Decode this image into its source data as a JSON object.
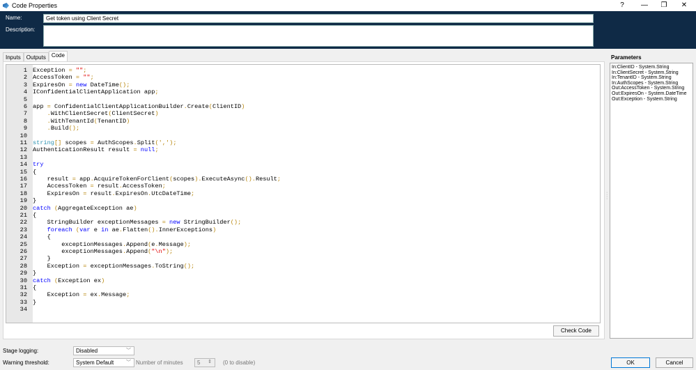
{
  "window": {
    "title": "Code Properties",
    "help": "?",
    "minimize": "—",
    "restore": "❐",
    "close": "✕"
  },
  "header": {
    "name_label": "Name:",
    "name_value": "Get token using Client Secret",
    "description_label": "Description:",
    "description_value": ""
  },
  "tabs": [
    {
      "label": "Inputs"
    },
    {
      "label": "Outputs"
    },
    {
      "label": "Code"
    }
  ],
  "code_lines": [
    "Exception = \"\";",
    "AccessToken = \"\";",
    "ExpiresOn = new DateTime();",
    "IConfidentialClientApplication app;",
    "",
    "app = ConfidentialClientApplicationBuilder.Create(ClientID)",
    "    .WithClientSecret(ClientSecret)",
    "    .WithTenantId(TenantID)",
    "    .Build();",
    "",
    "string[] scopes = AuthScopes.Split(',');",
    "AuthenticationResult result = null;",
    "",
    "try",
    "{",
    "    result = app.AcquireTokenForClient(scopes).ExecuteAsync().Result;",
    "    AccessToken = result.AccessToken;",
    "    ExpiresOn = result.ExpiresOn.UtcDateTime;",
    "}",
    "catch (AggregateException ae)",
    "{",
    "    StringBuilder exceptionMessages = new StringBuilder();",
    "    foreach (var e in ae.Flatten().InnerExceptions)",
    "    {",
    "        exceptionMessages.Append(e.Message);",
    "        exceptionMessages.Append(\"\\n\");",
    "    }",
    "    Exception = exceptionMessages.ToString();",
    "}",
    "catch (Exception ex)",
    "{",
    "    Exception = ex.Message;",
    "}",
    ""
  ],
  "check_code_label": "Check Code",
  "parameters": {
    "title": "Parameters",
    "items": [
      "In:ClientID - System.String",
      "In:ClientSecret - System.String",
      "In:TenantID - System.String",
      "In:AuthScopes - System.String",
      "Out:AccessToken - System.String",
      "Out:ExpiresOn - System.DateTime",
      "Out:Exception - System.String"
    ]
  },
  "footer": {
    "stage_logging_label": "Stage logging:",
    "stage_logging_value": "Disabled",
    "warning_label": "Warning threshold:",
    "warning_value": "System Default",
    "minutes_label": "Number of minutes",
    "minutes_value": "5",
    "disable_hint": "(0 to disable)",
    "ok_label": "OK",
    "cancel_label": "Cancel"
  },
  "colors": {
    "header_bg": "#0f2a46",
    "keyword": "#0000ff",
    "type": "#2b91af",
    "string": "#e00000",
    "punct": "#b8860b"
  }
}
